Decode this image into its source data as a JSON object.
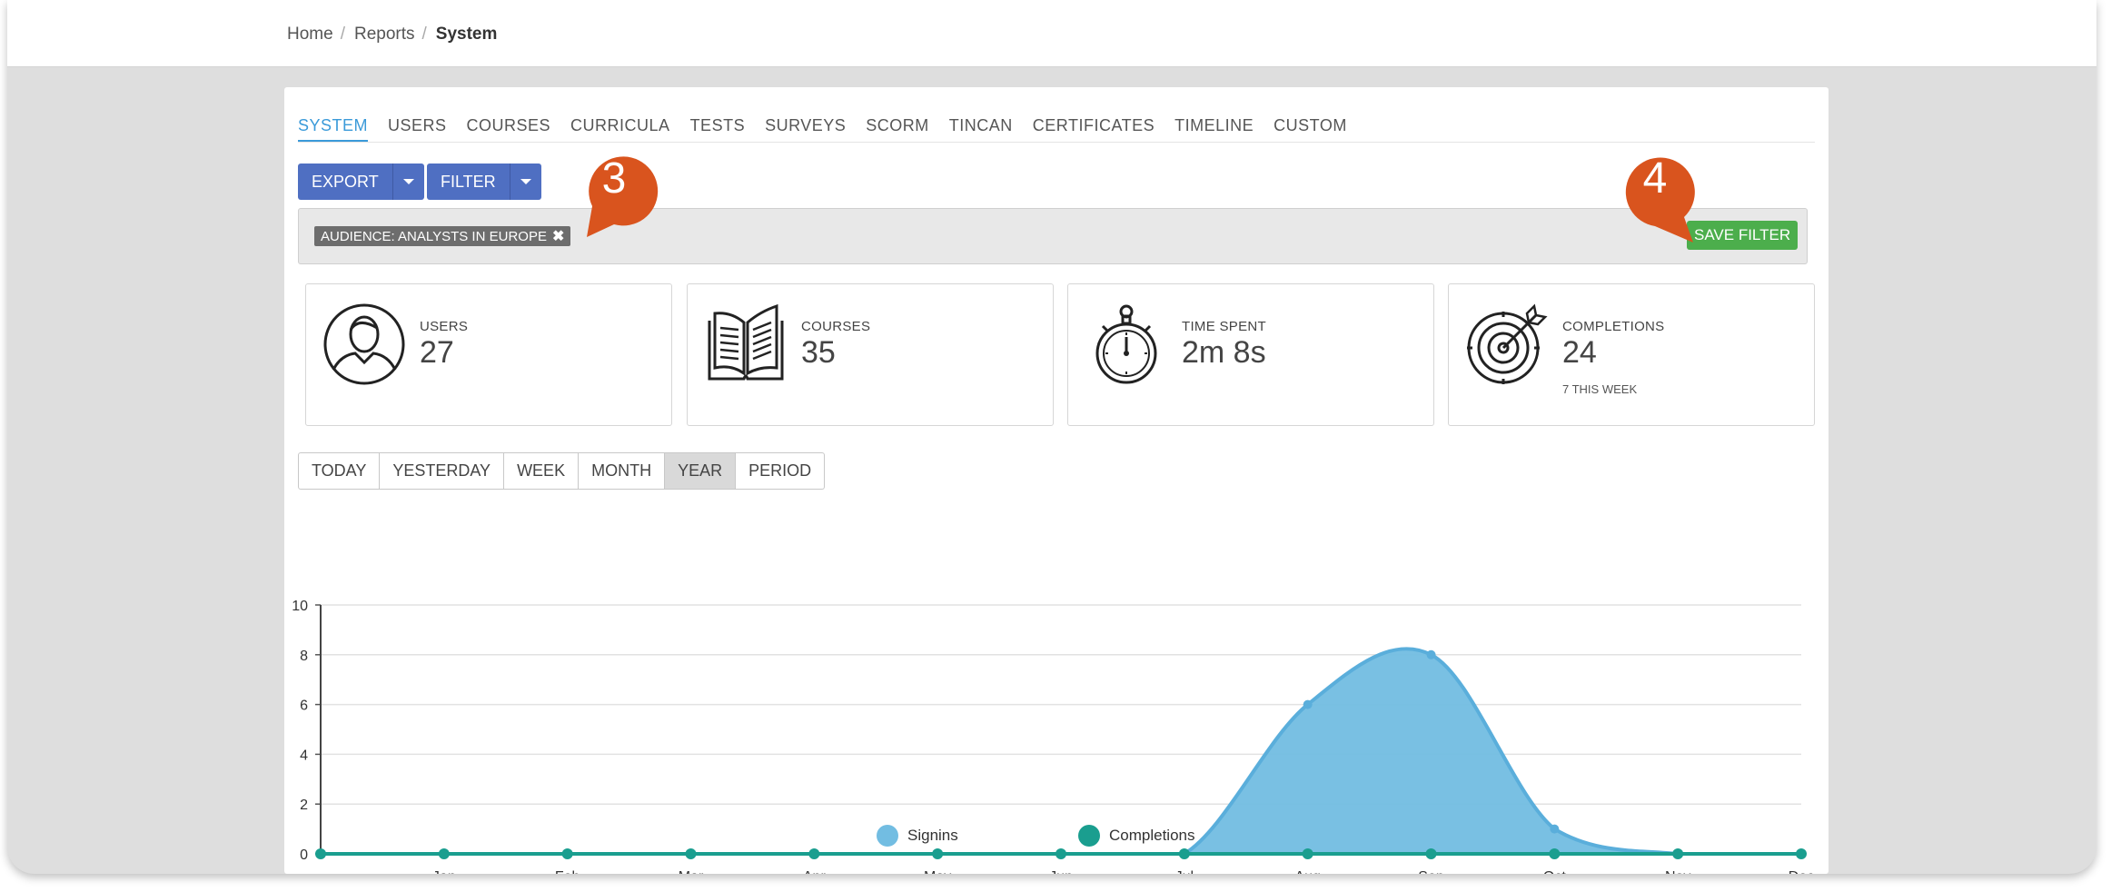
{
  "breadcrumb": {
    "home": "Home",
    "reports": "Reports",
    "current": "System"
  },
  "tabs": [
    {
      "label": "SYSTEM",
      "active": true
    },
    {
      "label": "USERS"
    },
    {
      "label": "COURSES"
    },
    {
      "label": "CURRICULA"
    },
    {
      "label": "TESTS"
    },
    {
      "label": "SURVEYS"
    },
    {
      "label": "SCORM"
    },
    {
      "label": "TINCAN"
    },
    {
      "label": "CERTIFICATES"
    },
    {
      "label": "TIMELINE"
    },
    {
      "label": "CUSTOM"
    }
  ],
  "toolbar": {
    "export_label": "EXPORT",
    "filter_label": "FILTER"
  },
  "filter": {
    "chip_label": "AUDIENCE: ANALYSTS IN EUROPE",
    "chip_remove": "✖",
    "save_label": "SAVE FILTER"
  },
  "callouts": {
    "first": "3",
    "second": "4"
  },
  "stats": {
    "users": {
      "label": "USERS",
      "value": "27",
      "icon": "user-icon"
    },
    "courses": {
      "label": "COURSES",
      "value": "35",
      "icon": "book-icon"
    },
    "time": {
      "label": "TIME SPENT",
      "value": "2m 8s",
      "icon": "stopwatch-icon"
    },
    "completions": {
      "label": "COMPLETIONS",
      "value": "24",
      "sub": "7 THIS WEEK",
      "icon": "target-icon"
    }
  },
  "ranges": [
    {
      "label": "TODAY"
    },
    {
      "label": "YESTERDAY"
    },
    {
      "label": "WEEK"
    },
    {
      "label": "MONTH"
    },
    {
      "label": "YEAR",
      "active": true
    },
    {
      "label": "PERIOD"
    }
  ],
  "colors": {
    "signins": "#72bde2",
    "completions": "#1a9e8f",
    "accent": "#3a9ad9",
    "callout": "#d9541e"
  },
  "chart_data": {
    "type": "area",
    "categories": [
      "",
      "Jan",
      "Feb",
      "Mar",
      "Apr",
      "May",
      "Jun",
      "Jul",
      "Aug",
      "Sep",
      "Oct",
      "Nov",
      "Dec"
    ],
    "ylim": [
      0,
      10
    ],
    "yticks": [
      0,
      2,
      4,
      6,
      8,
      10
    ],
    "grid": true,
    "legend_placement": "bottom-center",
    "series": [
      {
        "name": "Signins",
        "values": [
          0,
          0,
          0,
          0,
          0,
          0,
          0,
          0,
          6,
          8,
          1,
          0,
          0
        ]
      },
      {
        "name": "Completions",
        "values": [
          0,
          0,
          0,
          0,
          0,
          0,
          0,
          0,
          0,
          0,
          0,
          0,
          0
        ]
      }
    ]
  }
}
